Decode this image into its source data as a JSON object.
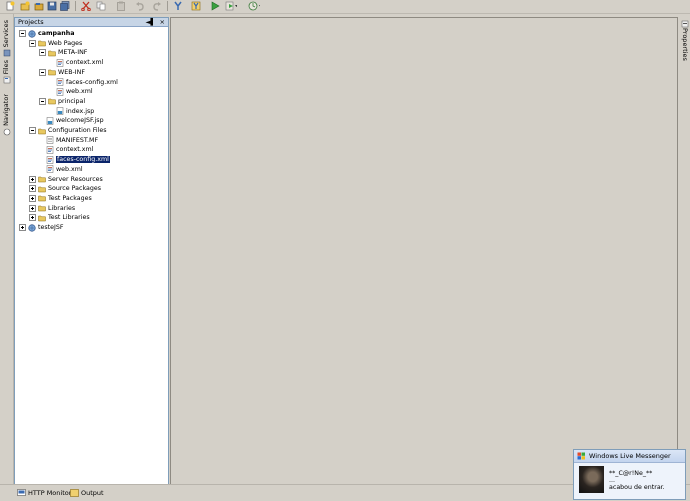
{
  "toolbar": {
    "icons": [
      "new-file-icon",
      "new-project-icon",
      "open-project-icon",
      "save-icon",
      "save-all-icon",
      "cut-icon",
      "copy-icon",
      "paste-icon",
      "undo-icon",
      "redo-icon",
      "build-icon",
      "clean-build-icon",
      "run-icon",
      "debug-icon",
      "profile-icon"
    ]
  },
  "left_tabs": [
    "Services",
    "Files",
    "Navigator"
  ],
  "right_tabs": [
    "Properties"
  ],
  "projects_panel": {
    "title": "Projects",
    "controls": [
      "◄▌",
      "×"
    ]
  },
  "tree": [
    {
      "label": "campanha",
      "depth": 0,
      "expander": "minus",
      "icon": "globe",
      "bold": true
    },
    {
      "label": "Web Pages",
      "depth": 1,
      "expander": "minus",
      "icon": "folder"
    },
    {
      "label": "META-INF",
      "depth": 2,
      "expander": "minus",
      "icon": "folder"
    },
    {
      "label": "context.xml",
      "depth": 3,
      "expander": "none",
      "icon": "xml"
    },
    {
      "label": "WEB-INF",
      "depth": 2,
      "expander": "minus",
      "icon": "folder"
    },
    {
      "label": "faces-config.xml",
      "depth": 3,
      "expander": "none",
      "icon": "xml"
    },
    {
      "label": "web.xml",
      "depth": 3,
      "expander": "none",
      "icon": "xml"
    },
    {
      "label": "principal",
      "depth": 2,
      "expander": "minus",
      "icon": "folder"
    },
    {
      "label": "index.jsp",
      "depth": 3,
      "expander": "none",
      "icon": "jsp"
    },
    {
      "label": "welcomeJSF.jsp",
      "depth": 2,
      "expander": "none",
      "icon": "jsp"
    },
    {
      "label": "Configuration Files",
      "depth": 1,
      "expander": "minus",
      "icon": "folder"
    },
    {
      "label": "MANIFEST.MF",
      "depth": 2,
      "expander": "none",
      "icon": "file"
    },
    {
      "label": "context.xml",
      "depth": 2,
      "expander": "none",
      "icon": "xml"
    },
    {
      "label": "faces-config.xml",
      "depth": 2,
      "expander": "none",
      "icon": "xml",
      "selected": true
    },
    {
      "label": "web.xml",
      "depth": 2,
      "expander": "none",
      "icon": "xml"
    },
    {
      "label": "Server Resources",
      "depth": 1,
      "expander": "plus",
      "icon": "folder"
    },
    {
      "label": "Source Packages",
      "depth": 1,
      "expander": "plus",
      "icon": "folder"
    },
    {
      "label": "Test Packages",
      "depth": 1,
      "expander": "plus",
      "icon": "folder"
    },
    {
      "label": "Libraries",
      "depth": 1,
      "expander": "plus",
      "icon": "folder"
    },
    {
      "label": "Test Libraries",
      "depth": 1,
      "expander": "plus",
      "icon": "folder"
    },
    {
      "label": "testeJSF",
      "depth": 0,
      "expander": "plus",
      "icon": "globe"
    }
  ],
  "bottom_tabs": [
    {
      "label": "HTTP Monitor",
      "icon": "monitor-icon"
    },
    {
      "label": "Output",
      "icon": "output-icon"
    }
  ],
  "messenger": {
    "title": "Windows Live Messenger",
    "name": "**_C@r!Ne_**",
    "dots": "...",
    "message": "acabou de entrar."
  },
  "colors": {
    "selection": "#0a246a",
    "panel_header": "#c7d5e6",
    "background": "#d4d0c8"
  }
}
